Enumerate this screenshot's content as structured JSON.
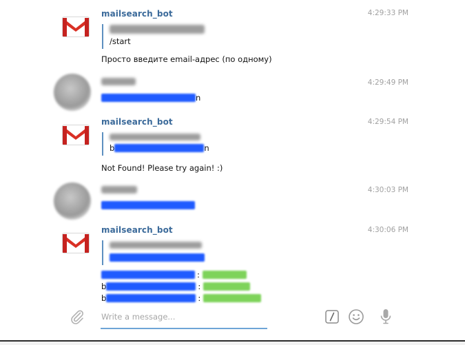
{
  "messages": [
    {
      "sender": "mailsearch_bot",
      "time": "4:29:33 PM",
      "quote_command": "/start",
      "text": "Просто введите email-адрес (по одному)"
    },
    {
      "time": "4:29:49 PM",
      "trailing_char": "n"
    },
    {
      "sender": "mailsearch_bot",
      "time": "4:29:54 PM",
      "quote_lead_char": "b",
      "quote_trailing_char": "n",
      "text": "Not Found! Please try again! :)"
    },
    {
      "time": "4:30:03 PM"
    },
    {
      "sender": "mailsearch_bot",
      "time": "4:30:06 PM",
      "result_separator": ":",
      "result_lead_char": "b"
    }
  ],
  "composer": {
    "placeholder": "Write a message..."
  },
  "icons": {
    "bot_avatar": "gmail-logo-icon",
    "attach": "paperclip-icon",
    "commands": "slash-command-icon",
    "emoji": "smiley-icon",
    "voice": "microphone-icon"
  },
  "colors": {
    "sender_name": "#3b6a9a",
    "quote_bar": "#5d8fc0",
    "redaction_blue": "#1f5bff",
    "redaction_green": "#7ed35a",
    "redaction_grey": "#9d9d9d",
    "input_underline": "#6ea4d6"
  }
}
